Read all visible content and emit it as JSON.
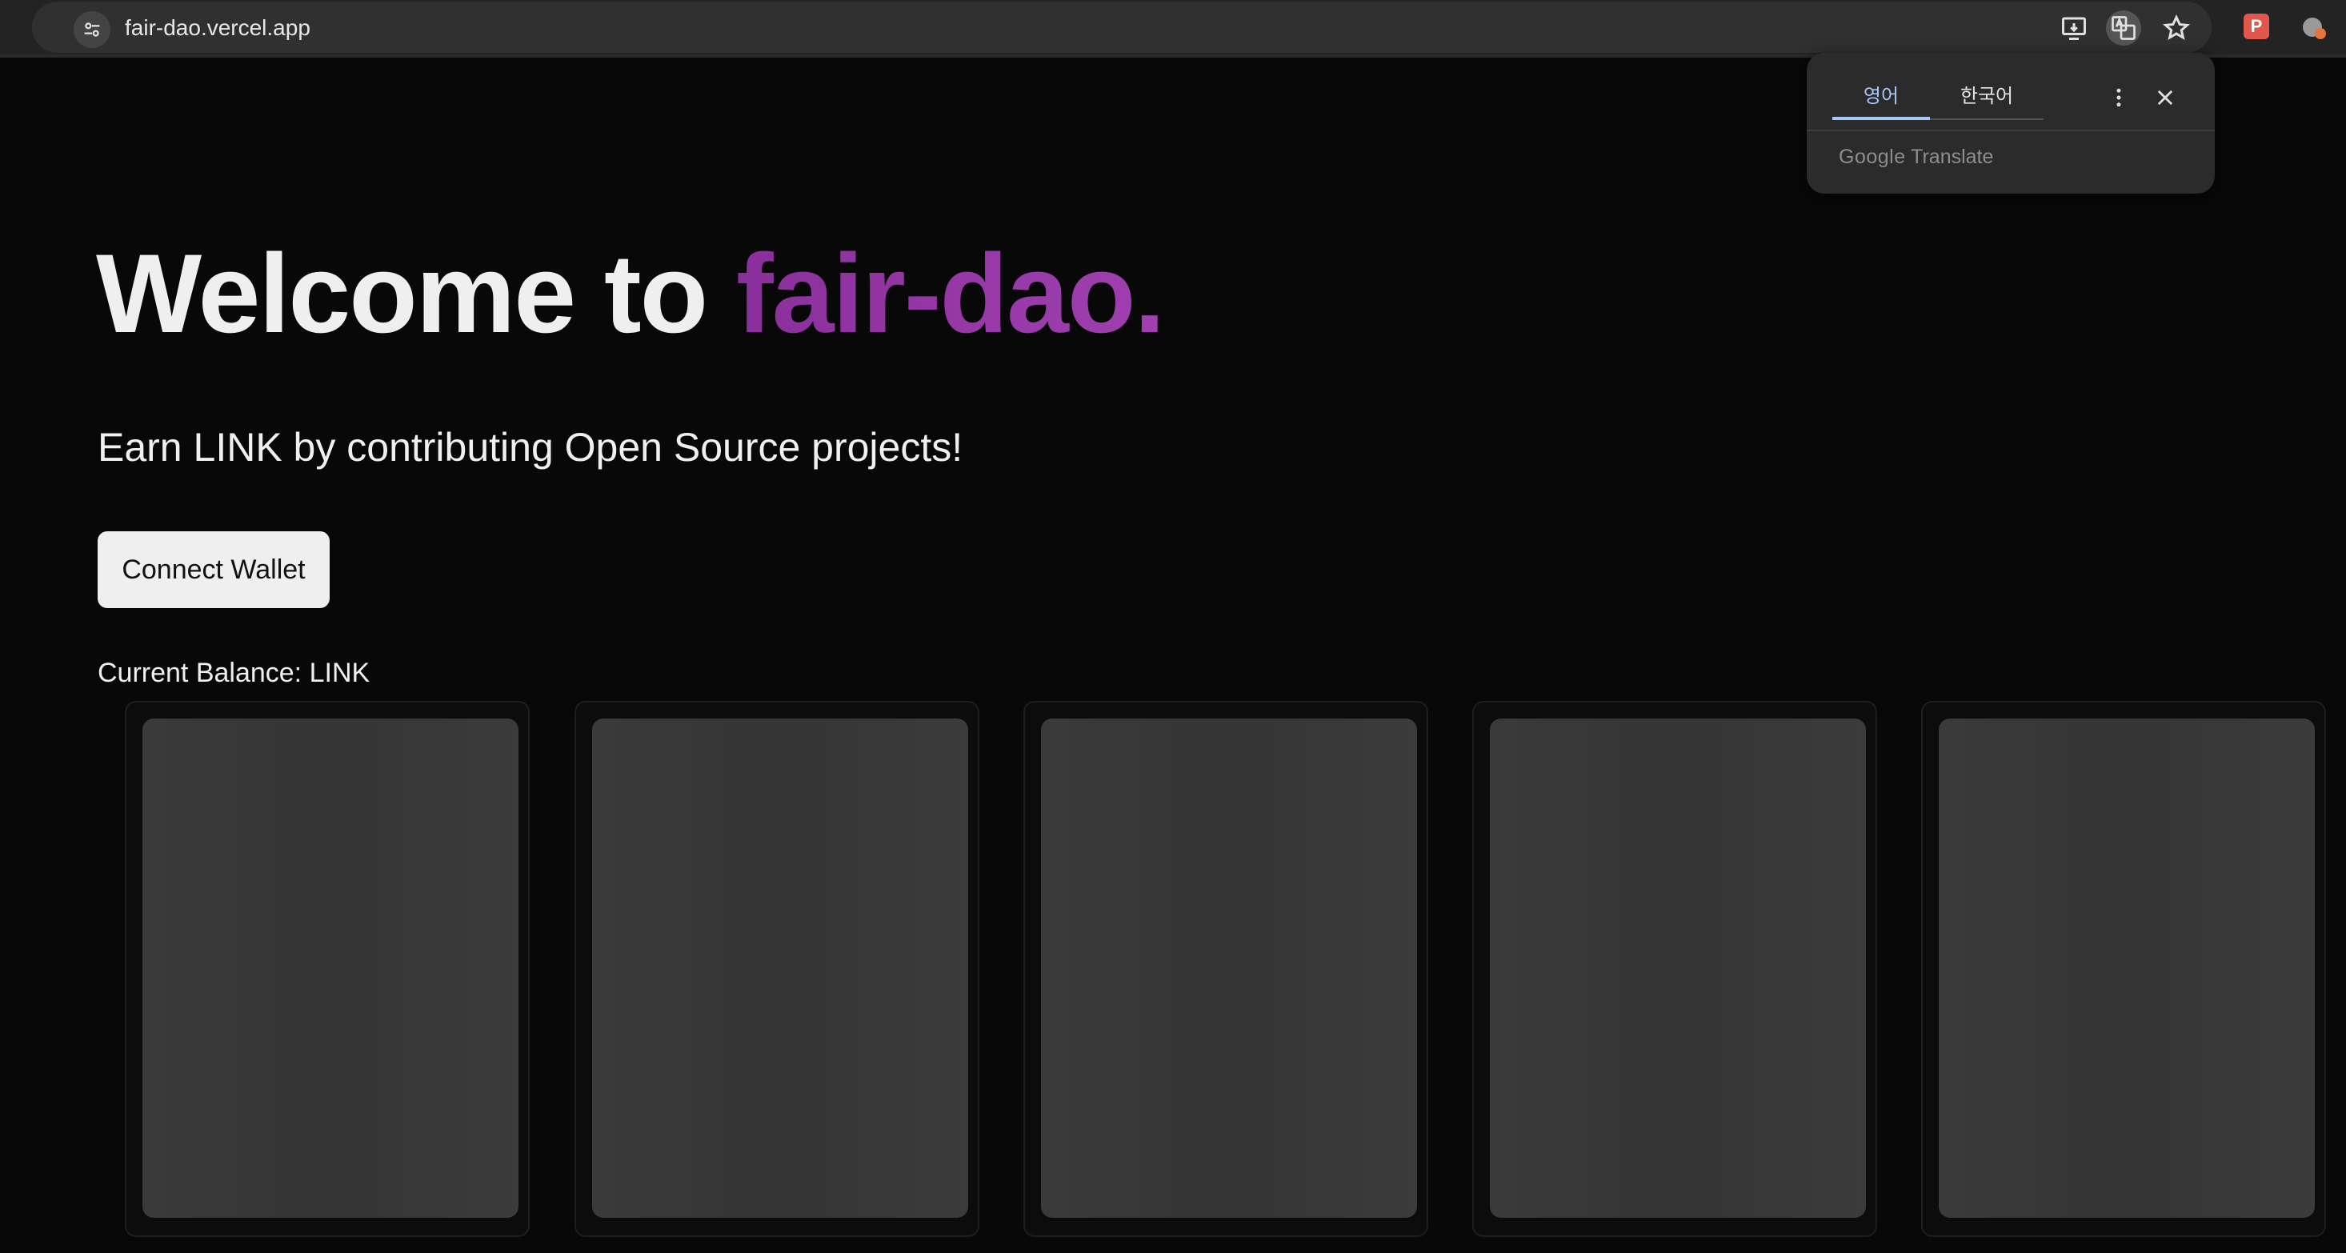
{
  "browser": {
    "url": "fair-dao.vercel.app",
    "icons": [
      "tune-icon",
      "install-app-icon",
      "translate-icon",
      "star-icon",
      "extension-red-icon",
      "profile-icon"
    ],
    "ext_red_label": "P"
  },
  "translate_popup": {
    "tabs": [
      {
        "label": "영어",
        "selected": true
      },
      {
        "label": "한국어",
        "selected": false
      }
    ],
    "brand_google": "Google",
    "brand_translate": "Translate",
    "accent_color": "#a8c7fa"
  },
  "page": {
    "headline_prefix": "Welcome to ",
    "headline_brand": "fair-dao.",
    "brand_color": "#8a2f9c",
    "subtitle": "Earn LINK by contributing Open Source projects!",
    "connect_button": "Connect Wallet",
    "balance_label": "Current Balance:",
    "balance_unit": "LINK",
    "cards": [
      {
        "state": "loading"
      },
      {
        "state": "loading"
      },
      {
        "state": "loading"
      },
      {
        "state": "loading"
      },
      {
        "state": "loading"
      }
    ]
  }
}
